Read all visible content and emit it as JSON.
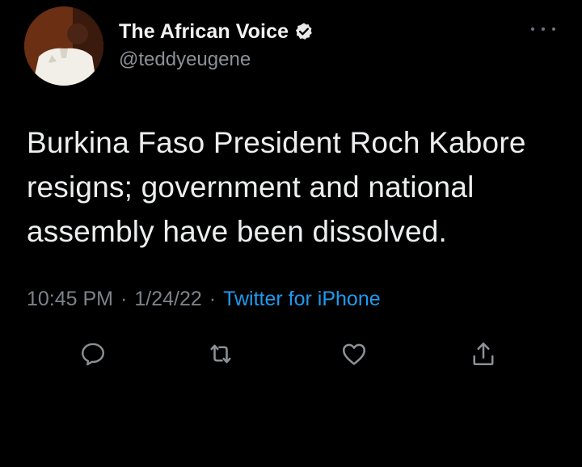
{
  "tweet": {
    "author": {
      "display_name": "The African Voice",
      "handle": "@teddyeugene",
      "verified_icon": "verified-badge-icon"
    },
    "text": "Burkina Faso President Roch Kabore resigns; government and national assembly have been dissolved.",
    "meta": {
      "time": "10:45 PM",
      "separator": "·",
      "date": "1/24/22",
      "source": "Twitter for iPhone"
    },
    "actions": [
      {
        "name": "reply",
        "icon": "reply-icon"
      },
      {
        "name": "retweet",
        "icon": "retweet-icon"
      },
      {
        "name": "like",
        "icon": "heart-icon"
      },
      {
        "name": "share",
        "icon": "share-icon"
      }
    ]
  },
  "colors": {
    "background": "#000000",
    "primary_text": "#e7e9ea",
    "secondary_text": "#7c838a",
    "link": "#1d9bf0"
  }
}
